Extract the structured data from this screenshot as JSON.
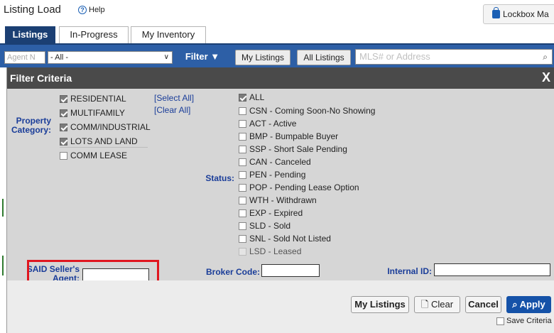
{
  "header": {
    "title": "Listing Load",
    "help_label": "Help",
    "lockbox_label": "Lockbox Ma"
  },
  "tabs": [
    {
      "label": "Listings"
    },
    {
      "label": "In-Progress"
    },
    {
      "label": "My Inventory"
    }
  ],
  "filter_bar": {
    "agent_placeholder": "Agent N",
    "agent_select_value": "- All -",
    "filter_label": "Filter ▼",
    "my_listings_label": "My Listings",
    "all_listings_label": "All Listings",
    "search_placeholder": "MLS# or Address"
  },
  "modal": {
    "title": "Filter Criteria",
    "close_label": "X",
    "property_category": {
      "label": "Property Category:",
      "select_all": "[Select All]",
      "clear_all": "[Clear All]",
      "options": [
        {
          "label": "RESIDENTIAL",
          "checked": true
        },
        {
          "label": "MULTIFAMILY",
          "checked": true
        },
        {
          "label": "COMM/INDUSTRIAL",
          "checked": true
        },
        {
          "label": "LOTS AND LAND",
          "checked": true
        },
        {
          "label": "COMM LEASE",
          "checked": false
        }
      ]
    },
    "status": {
      "label": "Status:",
      "options": [
        {
          "label": "ALL",
          "checked": true
        },
        {
          "label": "CSN - Coming Soon-No Showing",
          "checked": false
        },
        {
          "label": "ACT - Active",
          "checked": false
        },
        {
          "label": "BMP - Bumpable Buyer",
          "checked": false
        },
        {
          "label": "SSP - Short Sale Pending",
          "checked": false
        },
        {
          "label": "CAN - Canceled",
          "checked": false
        },
        {
          "label": "PEN - Pending",
          "checked": false
        },
        {
          "label": "POP - Pending Lease Option",
          "checked": false
        },
        {
          "label": "WTH - Withdrawn",
          "checked": false
        },
        {
          "label": "EXP - Expired",
          "checked": false
        },
        {
          "label": "SLD - Sold",
          "checked": false
        },
        {
          "label": "SNL - Sold Not Listed",
          "checked": false
        },
        {
          "label": "LSD - Leased",
          "checked": false,
          "disabled": true
        }
      ]
    },
    "said_label_1": "SAID Seller's",
    "said_label_2": "Agent:",
    "said_value": "",
    "broker_code_label": "Broker Code:",
    "broker_code_value": "",
    "internal_id_label": "Internal ID:",
    "internal_id_value": "",
    "footer": {
      "my_listings": "My Listings",
      "clear": "Clear",
      "cancel": "Cancel",
      "apply": "Apply",
      "save_criteria": "Save Criteria"
    }
  },
  "colors": {
    "tab_active": "#1b3f73",
    "filter_bar": "#2d5fa6",
    "modal_header": "#4a4a4a",
    "label_blue": "#1a3d99",
    "highlight": "#e0161f",
    "apply": "#1552a8"
  }
}
